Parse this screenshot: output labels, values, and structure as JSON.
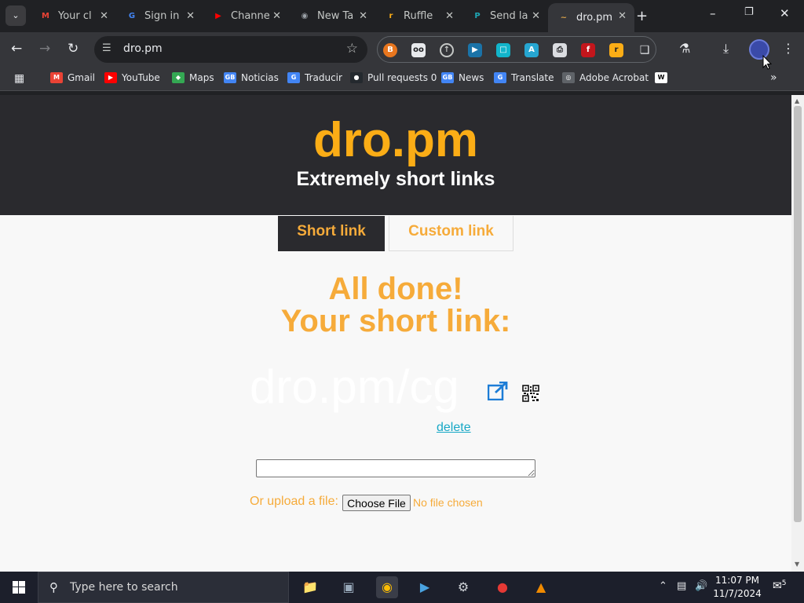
{
  "browser": {
    "tabs": [
      {
        "title": "Your cl",
        "favicon": "gmail-icon",
        "color": "#ea4335",
        "glyph": "M"
      },
      {
        "title": "Sign in",
        "favicon": "google-icon",
        "color": "#4285f4",
        "glyph": "G"
      },
      {
        "title": "Channe",
        "favicon": "youtube-icon",
        "color": "#ff0000",
        "glyph": "▶"
      },
      {
        "title": "New Ta",
        "favicon": "chrome-icon",
        "color": "#9aa0a6",
        "glyph": "◉"
      },
      {
        "title": "Ruffle",
        "favicon": "ruffle-icon",
        "color": "#fbad16",
        "glyph": "r"
      },
      {
        "title": "Send la",
        "favicon": "cloud-icon",
        "color": "#1ea7b5",
        "glyph": "P"
      },
      {
        "title": "dro.pm",
        "favicon": "dropm-icon",
        "color": "#d8a24a",
        "glyph": "~",
        "active": true
      }
    ],
    "address": "dro.pm",
    "bookmarks": [
      {
        "label": "Gmail",
        "icon": "gmail-icon",
        "color": "#ea4335",
        "glyph": "M"
      },
      {
        "label": "YouTube",
        "icon": "youtube-icon",
        "color": "#ff0000",
        "glyph": "▶"
      },
      {
        "label": "Maps",
        "icon": "maps-icon",
        "color": "#34a853",
        "glyph": "◆"
      },
      {
        "label": "Noticias",
        "icon": "news-icon",
        "color": "#4285f4",
        "glyph": "GB"
      },
      {
        "label": "Traducir",
        "icon": "translate-icon",
        "color": "#4285f4",
        "glyph": "G"
      },
      {
        "label": "Pull requests 0",
        "icon": "github-icon",
        "color": "#24292e",
        "glyph": "●"
      },
      {
        "label": "News",
        "icon": "news-icon",
        "color": "#4285f4",
        "glyph": "GB"
      },
      {
        "label": "Translate",
        "icon": "translate-icon",
        "color": "#4285f4",
        "glyph": "G"
      },
      {
        "label": "Adobe Acrobat",
        "icon": "globe-icon",
        "color": "#5f6368",
        "glyph": "◎"
      },
      {
        "label": "",
        "icon": "wikipedia-icon",
        "color": "#ffffff",
        "glyph": "W"
      }
    ]
  },
  "site": {
    "logo": "dro.pm",
    "tagline": "Extremely short links",
    "tab_short": "Short link",
    "tab_custom": "Custom link",
    "done_line1": "All done!",
    "done_line2": "Your short link:",
    "short_link": "dro.pm/cg",
    "delete_label": "delete",
    "upload_label": "Or upload a file:",
    "choose_file": "Choose File",
    "no_file": "No file chosen",
    "link_value": "",
    "accent": "#f6ab3a",
    "logo_color": "#fbad16"
  },
  "taskbar": {
    "search_placeholder": "Type here to search",
    "time": "11:07 PM",
    "date": "11/7/2024",
    "notifications": "5"
  }
}
